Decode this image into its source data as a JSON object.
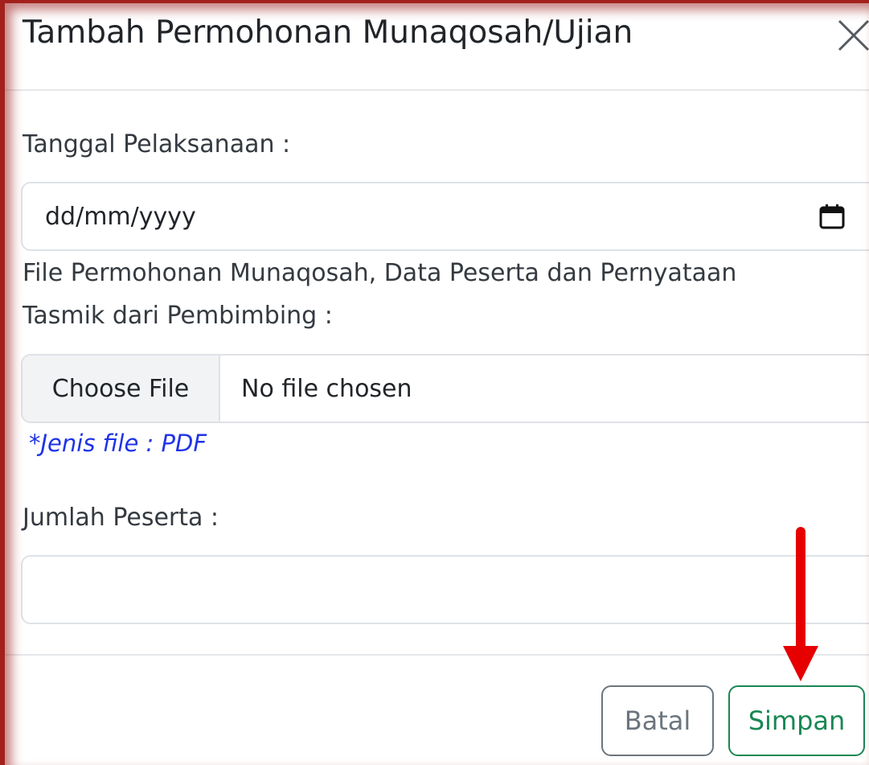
{
  "modal": {
    "title": "Tambah Permohonan Munaqosah/Ujian",
    "close_icon": "close-icon"
  },
  "form": {
    "date_label": "Tanggal Pelaksanaan :",
    "date_placeholder": "dd/mm/yyyy",
    "date_icon": "calendar-icon",
    "file_label_line1": "File Permohonan Munaqosah, Data Peserta dan Pernyataan",
    "file_label_line2": "Tasmik dari Pembimbing :",
    "file_button": "Choose File",
    "file_status": "No file chosen",
    "file_hint": "*Jenis file : PDF",
    "participants_label": "Jumlah Peserta :",
    "participants_value": ""
  },
  "footer": {
    "cancel_label": "Batal",
    "save_label": "Simpan"
  },
  "annotation": {
    "arrow_icon": "arrow-down-icon",
    "arrow_color": "#e60000"
  },
  "colors": {
    "hint": "#1f33e8",
    "save": "#198754",
    "cancel": "#6c757d",
    "frame": "#a3211c"
  }
}
